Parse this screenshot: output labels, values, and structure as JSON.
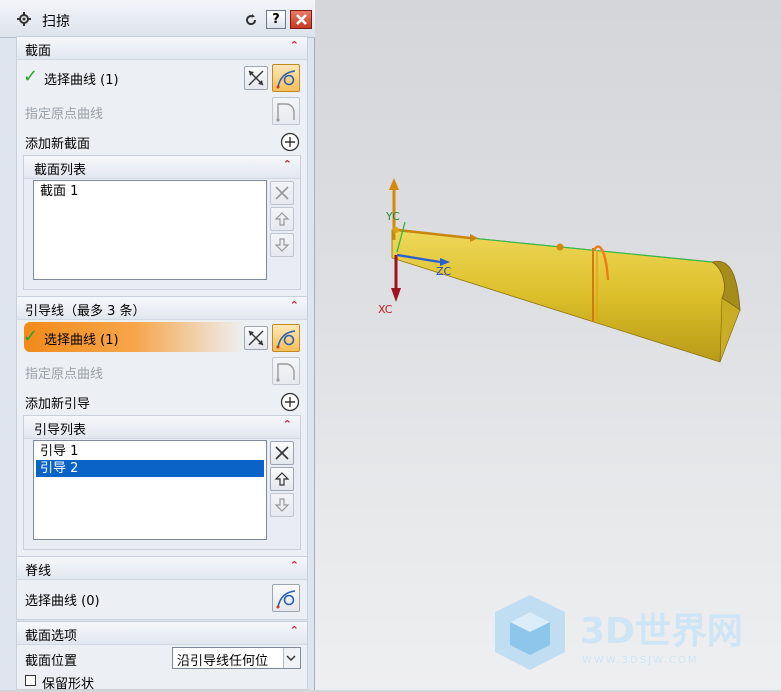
{
  "window": {
    "title": "扫掠"
  },
  "section_curve": {
    "header": "截面",
    "select_curve": "选择曲线 (1)",
    "origin_curve": "指定原点曲线",
    "add_new": "添加新截面",
    "list_header": "截面列表",
    "list_items": [
      "截面  1"
    ]
  },
  "guide": {
    "header": "引导线（最多 3 条）",
    "select_curve": "选择曲线 (1)",
    "origin_curve": "指定原点曲线",
    "add_new": "添加新引导",
    "list_header": "引导列表",
    "list_items": [
      "引导  1",
      "引导  2"
    ],
    "selected_index": 1
  },
  "spine": {
    "header": "脊线",
    "select_curve": "选择曲线 (0)"
  },
  "section_options": {
    "header": "截面选项",
    "position_label": "截面位置",
    "position_value": "沿引导线任何位",
    "preserve_shape": "保留形状"
  },
  "viewport": {
    "axis_x": "XC",
    "axis_y": "YC",
    "axis_z": "ZC",
    "surface_color": "#e5c733",
    "accent": "#f28a1b"
  },
  "watermark": {
    "brand": "3D世界网",
    "url": "WWW.3DSJW.COM"
  }
}
